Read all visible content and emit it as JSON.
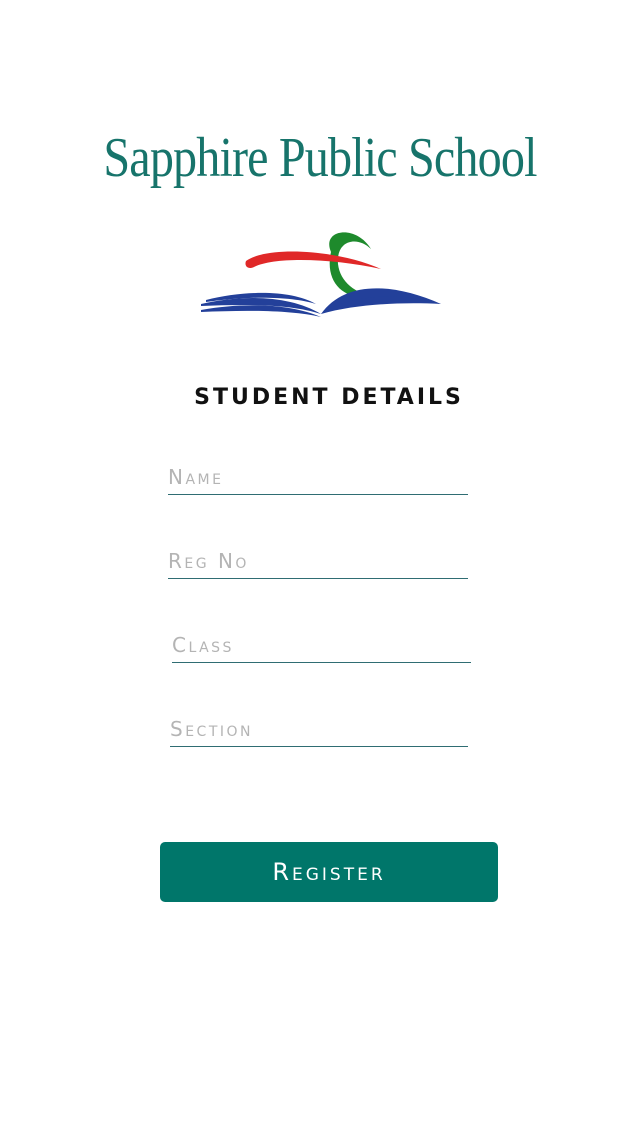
{
  "header": {
    "school_name": "Sapphire Public School"
  },
  "logo": {
    "icon": "open-book-swoosh-logo",
    "colors": {
      "red": "#e02828",
      "green": "#1e8a2c",
      "blue": "#23409a"
    }
  },
  "form": {
    "heading": "STUDENT DETAILS",
    "fields": {
      "name": {
        "placeholder": "Name",
        "value": ""
      },
      "reg_no": {
        "placeholder": "Reg No",
        "value": ""
      },
      "class": {
        "placeholder": "Class",
        "value": ""
      },
      "section": {
        "placeholder": "Section",
        "value": ""
      }
    },
    "submit_label": "Register"
  },
  "theme": {
    "accent": "#00766a",
    "title_color": "#17746b",
    "underline_color": "#2f6d73",
    "placeholder_color": "#b4b4b4"
  }
}
